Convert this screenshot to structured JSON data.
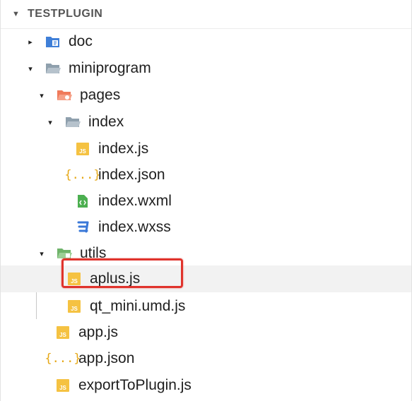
{
  "explorer": {
    "title": "TESTPLUGIN",
    "items": [
      {
        "label": "doc",
        "icon": "doc-folder-icon",
        "arrow": "▸"
      },
      {
        "label": "miniprogram",
        "icon": "folder-open-icon",
        "arrow": "▾"
      },
      {
        "label": "pages",
        "icon": "pages-folder-icon",
        "arrow": "▾"
      },
      {
        "label": "index",
        "icon": "folder-open-icon",
        "arrow": "▾"
      },
      {
        "label": "index.js",
        "icon": "js-file-icon"
      },
      {
        "label": "index.json",
        "icon": "json-file-icon"
      },
      {
        "label": "index.wxml",
        "icon": "wxml-file-icon"
      },
      {
        "label": "index.wxss",
        "icon": "css-file-icon"
      },
      {
        "label": "utils",
        "icon": "utils-folder-icon",
        "arrow": "▾"
      },
      {
        "label": "aplus.js",
        "icon": "js-file-icon"
      },
      {
        "label": "qt_mini.umd.js",
        "icon": "js-file-icon"
      },
      {
        "label": "app.js",
        "icon": "js-file-icon"
      },
      {
        "label": "app.json",
        "icon": "json-file-icon"
      },
      {
        "label": "exportToPlugin.js",
        "icon": "js-file-icon"
      }
    ]
  },
  "icon_glyphs": {
    "js": "JS",
    "json": "{...}"
  },
  "colors": {
    "highlight": "#e0332c",
    "js": "#f5c242",
    "folder": "#8fa0ad",
    "doc_folder": "#3f7fd8",
    "pages_folder": "#f07a5a",
    "utils_folder": "#6fb36a",
    "wxml": "#4caf50",
    "css": "#3a78d8"
  }
}
